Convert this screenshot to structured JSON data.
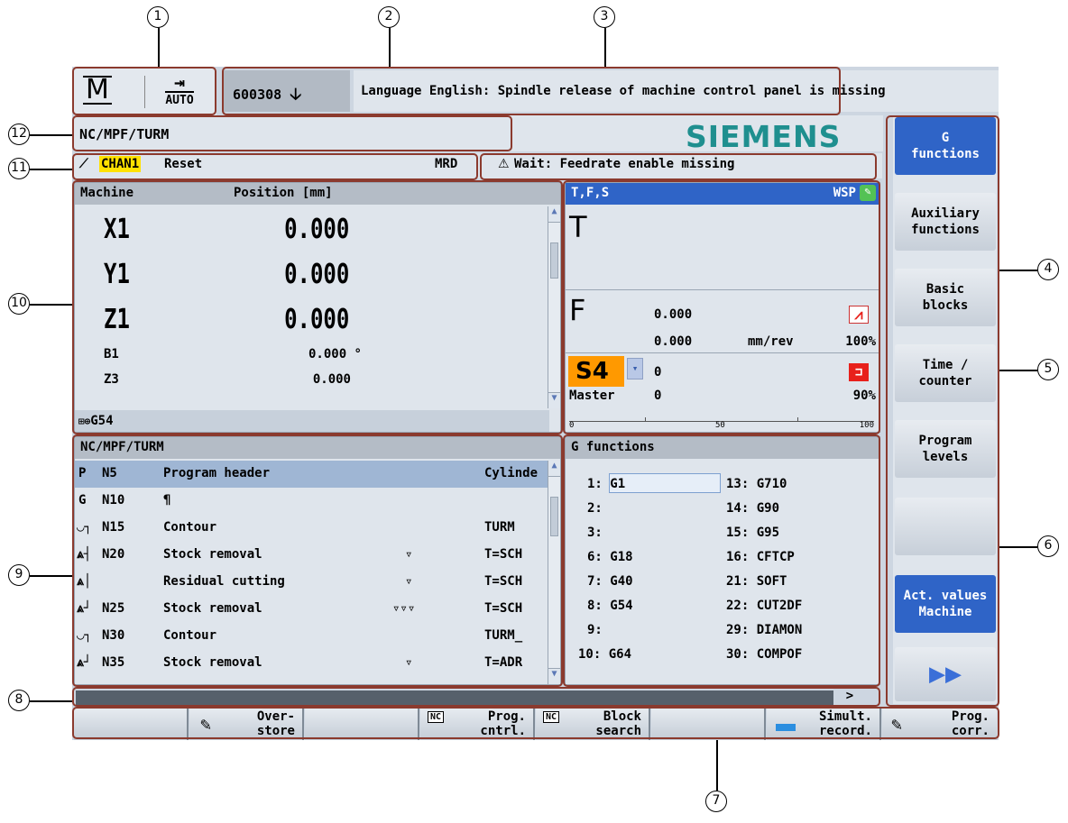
{
  "header": {
    "mode_letter": "M",
    "mode_name": "AUTO",
    "alarm_number": "600308",
    "alarm_text": "Language English: Spindle release of machine control panel is missing",
    "logo": "SIEMENS",
    "program_path": "NC/MPF/TURM"
  },
  "channel": {
    "name": "CHAN1",
    "state": "Reset",
    "mrd": "MRD",
    "message": "Wait: Feedrate enable missing"
  },
  "positions": {
    "title_left": "Machine",
    "title_right": "Position [mm]",
    "axes": [
      {
        "name": "X1",
        "value": "0.000"
      },
      {
        "name": "Y1",
        "value": "0.000"
      },
      {
        "name": "Z1",
        "value": "0.000"
      },
      {
        "name": "B1",
        "value": "0.000 °"
      },
      {
        "name": "Z3",
        "value": "0.000"
      }
    ],
    "work_offset": "G54"
  },
  "tfs": {
    "title": "T,F,S",
    "wsp": "WSP",
    "tool_label": "T",
    "feed_label": "F",
    "feed_value": "0.000",
    "feed_actual": "0.000",
    "feed_unit": "mm/rev",
    "feed_override": "100%",
    "spindle_label": "S4",
    "spindle_value": "0",
    "spindle_mode": "Master",
    "spindle_actual": "0",
    "spindle_override": "90%",
    "scale_min": "0",
    "scale_mid": "50",
    "scale_max": "100",
    "spindle_load_percent": 90
  },
  "program": {
    "title": "NC/MPF/TURM",
    "rows": [
      {
        "type": "P",
        "block": "N5",
        "text": "Program header",
        "mark": "",
        "param": "Cylinde"
      },
      {
        "type": "G",
        "block": "N10",
        "text": "¶",
        "mark": "",
        "param": ""
      },
      {
        "type": "contour",
        "block": "N15",
        "text": "Contour",
        "mark": "",
        "param": "TURM"
      },
      {
        "type": "stock",
        "block": "N20",
        "text": "Stock removal",
        "mark": "▿",
        "param": "T=SCH"
      },
      {
        "type": "stock2",
        "block": "",
        "text": "Residual cutting",
        "mark": "▿",
        "param": "T=SCH"
      },
      {
        "type": "stock",
        "block": "N25",
        "text": "Stock removal",
        "mark": "▿▿▿",
        "param": "T=SCH"
      },
      {
        "type": "contour",
        "block": "N30",
        "text": "Contour",
        "mark": "",
        "param": "TURM_"
      },
      {
        "type": "stock",
        "block": "N35",
        "text": "Stock removal",
        "mark": "▿",
        "param": "T=ADR"
      }
    ]
  },
  "gfunctions": {
    "title": "G functions",
    "left": [
      "1: G1",
      "2:",
      "3:",
      "6: G18",
      "7: G40",
      "8: G54",
      "9:",
      "10: G64"
    ],
    "right": [
      "13: G710",
      "14: G90",
      "15: G95",
      "16: CFTCP",
      "21: SOFT",
      "22: CUT2DF",
      "29: DIAMON",
      "30: COMPOF"
    ]
  },
  "vertical_softkeys": [
    {
      "label": "G\nfunctions",
      "active": true
    },
    {
      "label": "Auxiliary\nfunctions",
      "active": false
    },
    {
      "label": "Basic\nblocks",
      "active": false
    },
    {
      "label": "Time /\ncounter",
      "active": false
    },
    {
      "label": "Program\nlevels",
      "active": false
    },
    {
      "label": "",
      "active": false
    },
    {
      "label": "Act. values\nMachine",
      "active": true
    }
  ],
  "horizontal_softkeys": [
    {
      "label": ""
    },
    {
      "label": "Over-\nstore"
    },
    {
      "label": ""
    },
    {
      "label": "Prog.\ncntrl."
    },
    {
      "label": "Block\nsearch"
    },
    {
      "label": ""
    },
    {
      "label": "Simult.\nrecord."
    },
    {
      "label": "Prog.\ncorr."
    }
  ],
  "more_indicator": ">",
  "callouts": [
    "1",
    "2",
    "3",
    "4",
    "5",
    "6",
    "7",
    "8",
    "9",
    "10",
    "11",
    "12"
  ],
  "colors": {
    "frame": "#8b3a2e",
    "active_blue": "#2f64c7",
    "siemens": "#1f8f8f",
    "channel_flag": "#ffe100",
    "spindle_bg": "#ff9900",
    "alarm_red": "#e8201b"
  }
}
